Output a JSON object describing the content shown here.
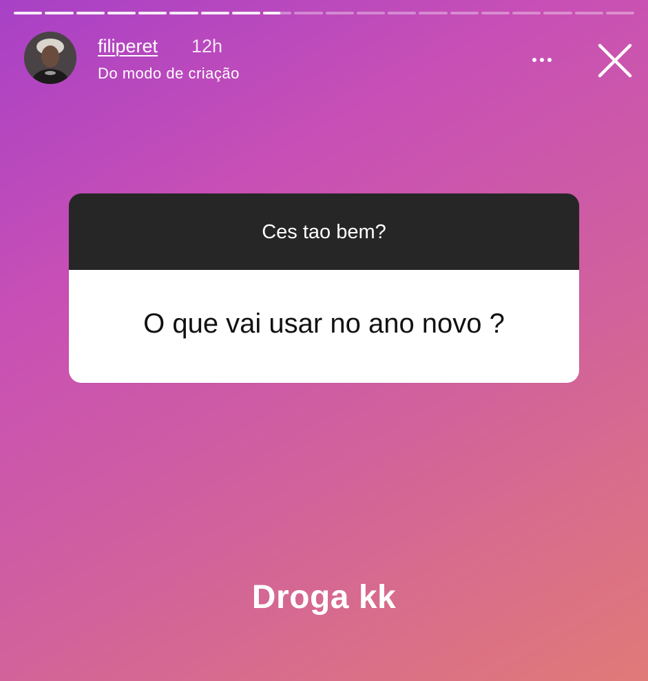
{
  "story": {
    "progress": {
      "segments_total": 20,
      "segments_completed": 8,
      "current_segment_fill": 0.6
    },
    "header": {
      "username": "filiperet",
      "time_ago": "12h",
      "subtitle": "Do modo de criação",
      "more_icon": "more-horizontal-icon",
      "close_icon": "close-icon"
    },
    "question_sticker": {
      "prompt": "Ces tao bem?",
      "answer": "O que vai usar no ano novo ?"
    },
    "reply_text": "Droga kk"
  },
  "colors": {
    "gradient_start": "#a841c6",
    "gradient_end": "#e07a78",
    "card_header_bg": "#262626",
    "card_body_bg": "#ffffff"
  }
}
